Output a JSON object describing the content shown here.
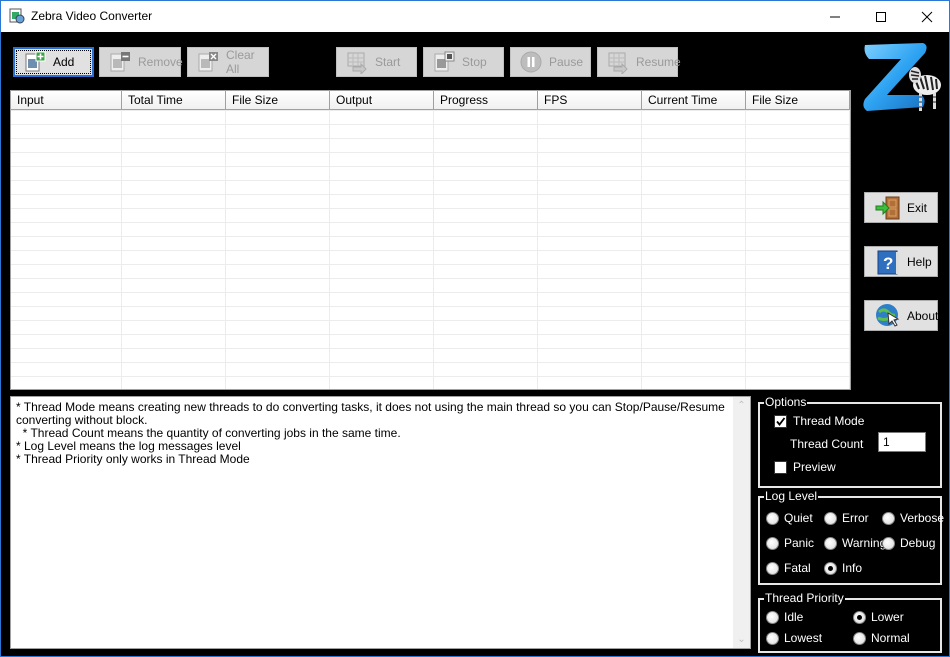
{
  "window": {
    "title": "Zebra Video Converter",
    "controls": {
      "minimize": "minimize-icon",
      "maximize": "maximize-icon",
      "close": "close-icon"
    }
  },
  "toolbar": {
    "buttons": [
      {
        "id": "add",
        "label": "Add",
        "icon": "add-file-icon",
        "enabled": true
      },
      {
        "id": "remove",
        "label": "Remove",
        "icon": "remove-file-icon",
        "enabled": false
      },
      {
        "id": "clear_all",
        "label": "Clear All",
        "icon": "clear-all-icon",
        "enabled": false
      },
      {
        "id": "start",
        "label": "Start",
        "icon": "start-icon",
        "enabled": false
      },
      {
        "id": "stop",
        "label": "Stop",
        "icon": "stop-icon",
        "enabled": false
      },
      {
        "id": "pause",
        "label": "Pause",
        "icon": "pause-icon",
        "enabled": false
      },
      {
        "id": "resume",
        "label": "Resume",
        "icon": "resume-icon",
        "enabled": false
      }
    ]
  },
  "table": {
    "columns": [
      "Input",
      "Total Time",
      "File Size",
      "Output",
      "Progress",
      "FPS",
      "Current Time",
      "File Size"
    ],
    "rows": []
  },
  "side_buttons": [
    {
      "id": "exit",
      "label": "Exit",
      "icon": "exit-door-icon"
    },
    {
      "id": "help",
      "label": "Help",
      "icon": "help-icon"
    },
    {
      "id": "about",
      "label": "About",
      "icon": "about-globe-icon"
    }
  ],
  "log": {
    "text": "* Thread Mode means creating new threads to do converting tasks, it does not using the main thread so you can Stop/Pause/Resume converting without block.\n  * Thread Count means the quantity of converting jobs in the same time.\n* Log Level means the log messages level\n* Thread Priority only works in Thread Mode"
  },
  "options": {
    "legend": "Options",
    "thread_mode": {
      "label": "Thread Mode",
      "checked": true
    },
    "thread_count": {
      "label": "Thread Count",
      "value": "1"
    },
    "preview": {
      "label": "Preview",
      "checked": false
    }
  },
  "log_level": {
    "legend": "Log Level",
    "options": [
      "Quiet",
      "Error",
      "Verbose",
      "Panic",
      "Warning",
      "Debug",
      "Fatal",
      "Info"
    ],
    "selected": "Info"
  },
  "thread_priority": {
    "legend": "Thread Priority",
    "options": [
      "Idle",
      "Lower",
      "Lowest",
      "Normal"
    ],
    "selected": "Lower"
  }
}
